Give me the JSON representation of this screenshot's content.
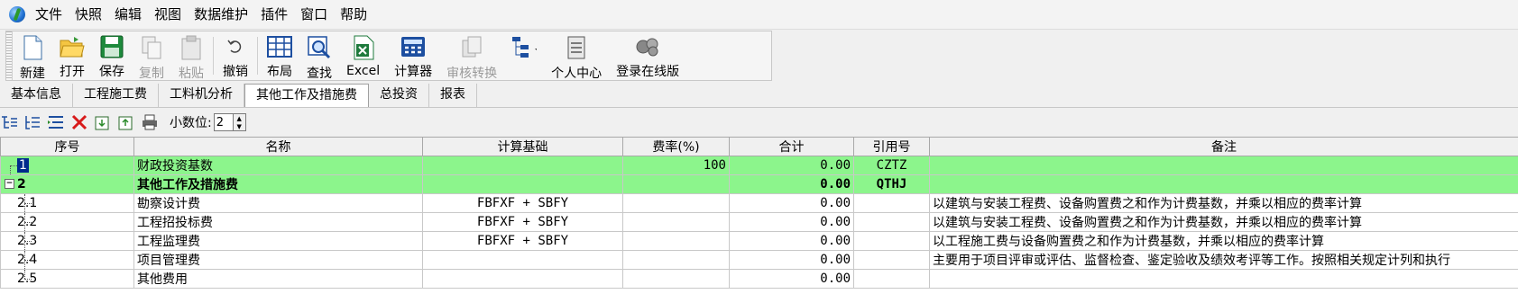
{
  "menu": [
    "文件",
    "快照",
    "编辑",
    "视图",
    "数据维护",
    "插件",
    "窗口",
    "帮助"
  ],
  "toolbar": {
    "new": "新建",
    "open": "打开",
    "save": "保存",
    "copy": "复制",
    "paste": "粘贴",
    "undo": "撤销",
    "layout": "布局",
    "find": "查找",
    "excel": "Excel",
    "calculator": "计算器",
    "review_convert": "审核转换",
    "personal_center": "个人中心",
    "login_online": "登录在线版"
  },
  "tabs": [
    "基本信息",
    "工程施工费",
    "工料机分析",
    "其他工作及措施费",
    "总投资",
    "报表"
  ],
  "active_tab": "其他工作及措施费",
  "subbar": {
    "decimal_label": "小数位:",
    "decimal_value": "2"
  },
  "grid": {
    "headers": [
      "序号",
      "名称",
      "计算基础",
      "费率(%)",
      "合计",
      "引用号",
      "备注"
    ],
    "rows": [
      {
        "seq": "1",
        "name": "财政投资基数",
        "base": "",
        "rate": "100",
        "total": "0.00",
        "ref": "CZTZ",
        "note": ""
      },
      {
        "seq": "2",
        "name": "其他工作及措施费",
        "base": "",
        "rate": "",
        "total": "0.00",
        "ref": "QTHJ",
        "note": ""
      },
      {
        "seq": "2.1",
        "name": "勘察设计费",
        "base": "FBFXF + SBFY",
        "rate": "",
        "total": "0.00",
        "ref": "",
        "note": "以建筑与安装工程费、设备购置费之和作为计费基数，并乘以相应的费率计算"
      },
      {
        "seq": "2.2",
        "name": "工程招投标费",
        "base": "FBFXF + SBFY",
        "rate": "",
        "total": "0.00",
        "ref": "",
        "note": "以建筑与安装工程费、设备购置费之和作为计费基数，并乘以相应的费率计算"
      },
      {
        "seq": "2.3",
        "name": "工程监理费",
        "base": "FBFXF + SBFY",
        "rate": "",
        "total": "0.00",
        "ref": "",
        "note": "以工程施工费与设备购置费之和作为计费基数，并乘以相应的费率计算"
      },
      {
        "seq": "2.4",
        "name": "项目管理费",
        "base": "",
        "rate": "",
        "total": "0.00",
        "ref": "",
        "note": "主要用于项目评审或评估、监督检查、鉴定验收及绩效考评等工作。按照相关规定计列和执行"
      },
      {
        "seq": "2.5",
        "name": "其他费用",
        "base": "",
        "rate": "",
        "total": "0.00",
        "ref": "",
        "note": ""
      }
    ]
  },
  "colors": {
    "row_highlight": "#8cf58c",
    "selection": "#002b8c"
  }
}
